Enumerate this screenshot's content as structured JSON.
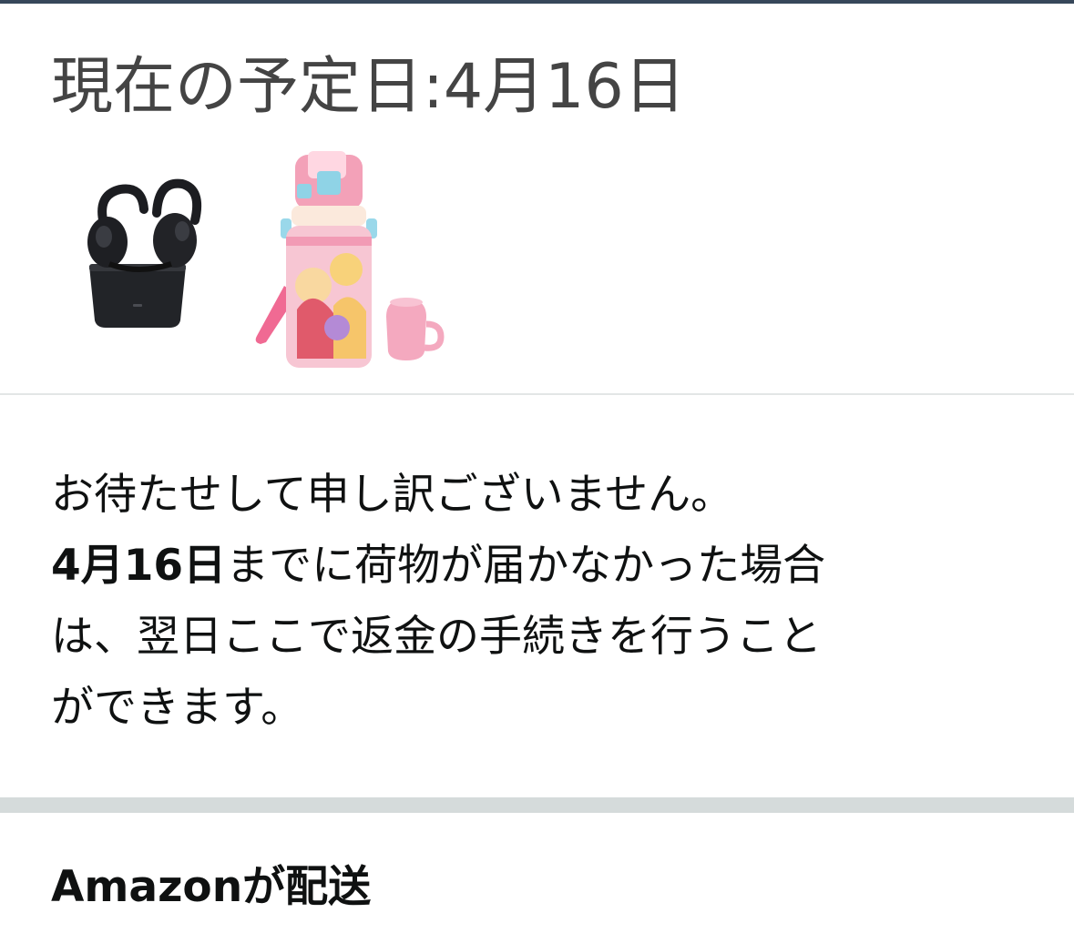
{
  "delivery": {
    "estimated_date": "現在の予定日:4月16日",
    "products": [
      {
        "icon": "wireless-earbuds-with-case-image"
      },
      {
        "icon": "pink-princess-water-bottle-image"
      }
    ]
  },
  "apology": {
    "line1": "お待たせして申し訳ございません。",
    "line2_date": "4月16日",
    "line2_rest": "までに荷物が届かなかった場合",
    "line3": "は、翌日ここで返金の手続きを行うこと",
    "line4": "ができます。"
  },
  "shipping": {
    "label": "Amazonが配送"
  },
  "colors": {
    "top_rule": "#37475a",
    "text_dark": "#0f1111",
    "text_heading": "#444444",
    "divider_thick": "#d5dbdb",
    "divider_thin": "#e3e6e6"
  }
}
